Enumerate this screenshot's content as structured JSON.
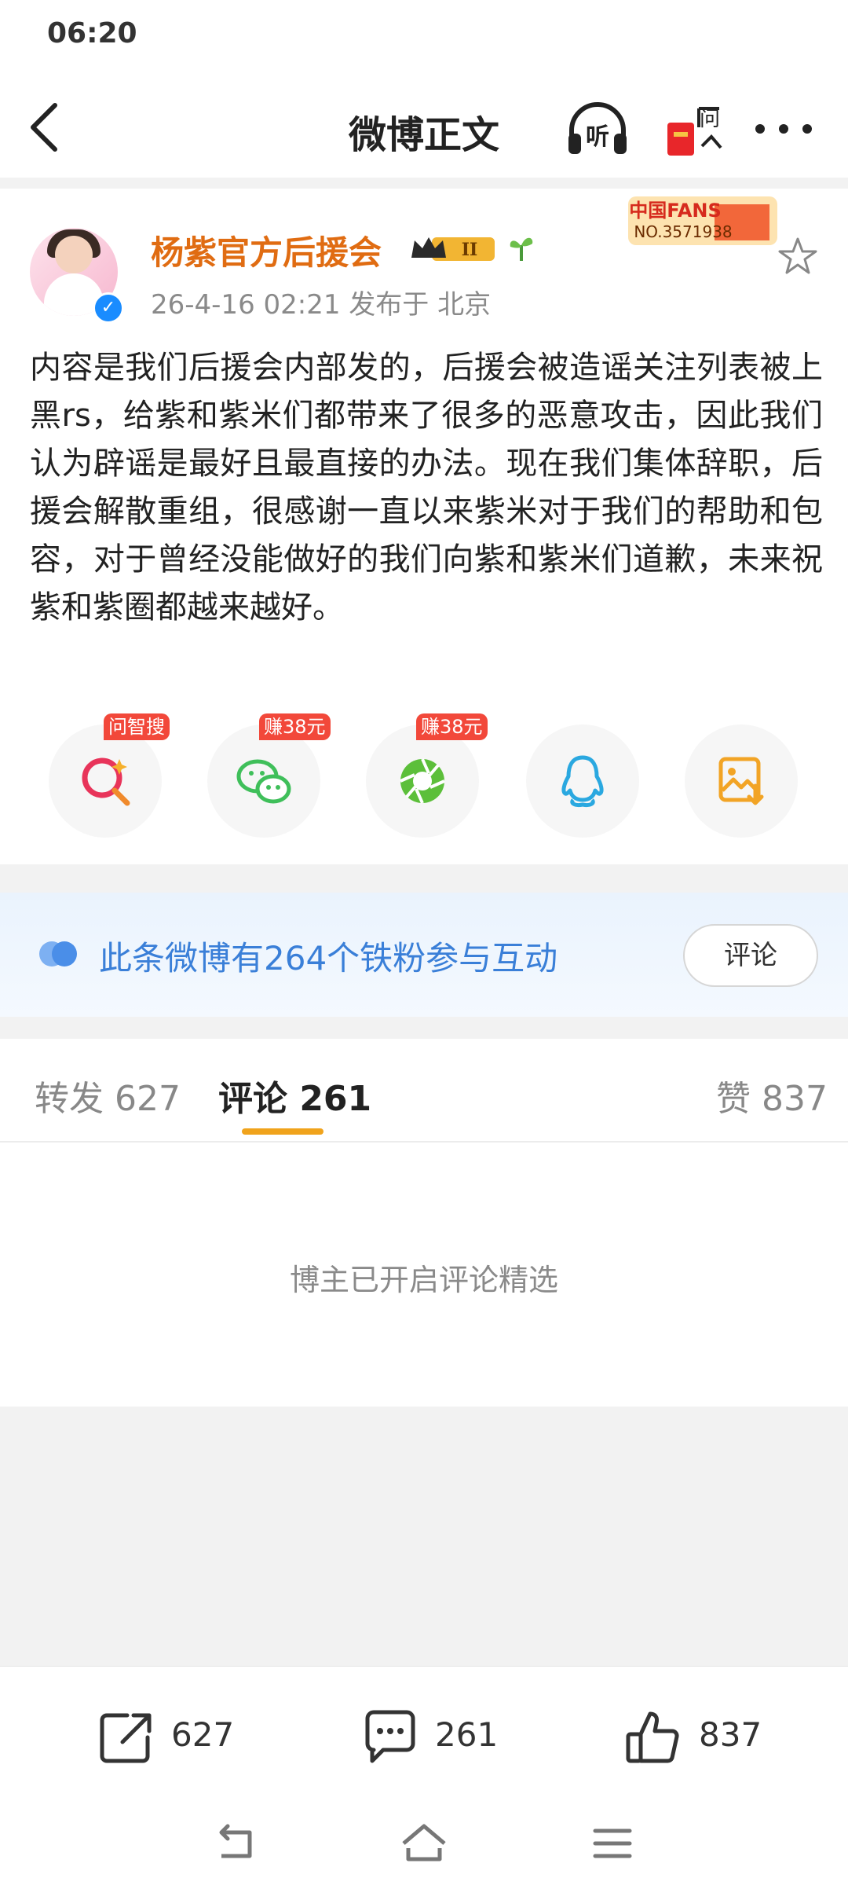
{
  "status_bar": {
    "time": "06:20"
  },
  "header": {
    "title": "微博正文",
    "listen_icon_text": "听",
    "ask_icon_text": "问"
  },
  "post": {
    "author": "杨紫官方后援会",
    "level_badge": "II",
    "fans_badge_line1": "中国FANS",
    "fans_badge_line2": "NO.3571938",
    "meta": "26-4-16 02:21  发布于 北京",
    "content": "内容是我们后援会内部发的，后援会被造谣关注列表被上黑rs，给紫和紫米们都带来了很多的恶意攻击，因此我们认为辟谣是最好且最直接的办法。现在我们集体辞职，后援会解散重组，很感谢一直以来紫米对于我们的帮助和包容，对于曾经没能做好的我们向紫和紫米们道歉，未来祝紫和紫圈都越来越好。",
    "share_tags": [
      "问智搜",
      "赚38元",
      "赚38元"
    ]
  },
  "banner": {
    "text": "此条微博有264个铁粉参与互动",
    "button": "评论"
  },
  "tabs": {
    "repost": "转发 627",
    "comments": "评论 261",
    "likes": "赞 837"
  },
  "comments_note": "博主已开启评论精选",
  "bottom_bar": {
    "repost_count": "627",
    "comment_count": "261",
    "like_count": "837"
  },
  "colors": {
    "username": "#e06c12",
    "accent_blue": "#3a7fd8",
    "tab_underline": "#f0a31c",
    "tag_red": "#f2483a"
  }
}
